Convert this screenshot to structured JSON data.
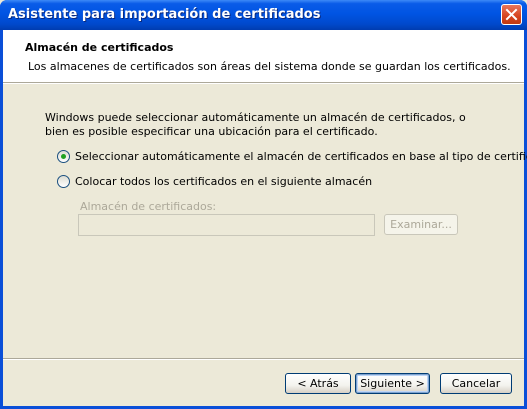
{
  "window": {
    "title": "Asistente para importación de certificados"
  },
  "header": {
    "title": "Almacén de certificados",
    "description": "Los almacenes de certificados son áreas del sistema donde se guardan los certificados."
  },
  "body": {
    "intro": "Windows puede seleccionar automáticamente un almacén de certificados, o bien es posible especificar una ubicación para el certificado.",
    "options": [
      {
        "label": "Seleccionar automáticamente el almacén de certificados en base al tipo de certificado",
        "selected": true
      },
      {
        "label": "Colocar todos los certificados en el siguiente almacén",
        "selected": false
      }
    ],
    "store": {
      "label": "Almacén de certificados:",
      "value": "",
      "browse_label": "Examinar...",
      "enabled": false
    }
  },
  "footer": {
    "back_label": "< Atrás",
    "next_label": "Siguiente >",
    "cancel_label": "Cancelar"
  },
  "colors": {
    "titlebar": "#0054e3",
    "dialog_bg": "#ece9d8",
    "radio_dot": "#21a121"
  }
}
